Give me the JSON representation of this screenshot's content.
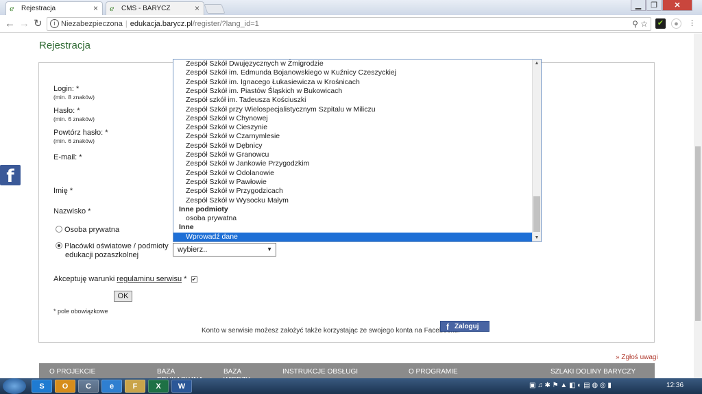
{
  "browser": {
    "tabs": [
      {
        "title": "Rejestracja"
      },
      {
        "title": "CMS - BARYCZ"
      }
    ],
    "address": {
      "security_label": "Niezabezpieczona",
      "host": "edukacja.barycz.pl",
      "path": "/register/?lang_id=1"
    }
  },
  "page": {
    "title": "Rejestracja",
    "fields": {
      "login": {
        "label": "Login: *",
        "hint": "(min. 8 znaków)"
      },
      "password": {
        "label": "Hasło: *",
        "hint": "(min. 6 znaków)"
      },
      "password_repeat": {
        "label": "Powtórz hasło: *",
        "hint": "(min. 6 znaków)"
      },
      "email": {
        "label": "E-mail: *"
      },
      "first_name": {
        "label": "Imię *"
      },
      "last_name": {
        "label": "Nazwisko *"
      }
    },
    "radio": {
      "private": "Osoba prywatna",
      "institution_line1": "Placówki oświatowe / podmioty",
      "institution_line2": "edukacji pozaszkolnej"
    },
    "select": {
      "value": "wybierz..",
      "options": [
        {
          "label": "Zespół Szkół Dwujęzycznych w Żmigrodzie"
        },
        {
          "label": "Zespół Szkół im. Edmunda Bojanowskiego w Kuźnicy Czeszyckiej"
        },
        {
          "label": "Zespół Szkół im. Ignacego Łukasiewicza w Krośnicach"
        },
        {
          "label": "Zespół Szkół im. Piastów Śląskich w Bukowicach"
        },
        {
          "label": "Zespół szkół im. Tadeusza Kościuszki"
        },
        {
          "label": "Zespół Szkół przy Wielospecjalistycznym Szpitalu w Miliczu"
        },
        {
          "label": "Zespół Szkół w Chynowej"
        },
        {
          "label": "Zespół Szkół w Cieszynie"
        },
        {
          "label": "Zespół Szkół w Czarnymlesie"
        },
        {
          "label": "Zespół Szkół w Dębnicy"
        },
        {
          "label": "Zespół Szkół w Granowcu"
        },
        {
          "label": "Zespół Szkół w Jankowie Przygodzkim"
        },
        {
          "label": "Zespół Szkół w Odolanowie"
        },
        {
          "label": "Zespół Szkół w Pawłowie"
        },
        {
          "label": "Zespół Szkół w Przygodzicach"
        },
        {
          "label": "Zespół Szkół w Wysocku Małym"
        },
        {
          "label": "Inne podmioty",
          "group": true
        },
        {
          "label": "osoba prywatna"
        },
        {
          "label": "Inne",
          "group": true
        },
        {
          "label": "Wprowadź dane",
          "selected": true
        }
      ]
    },
    "accept": {
      "prefix": "Akceptuję warunki",
      "link": "regulaminu serwisu",
      "suffix": "*",
      "checked": true
    },
    "ok_button": "OK",
    "required_note": "* pole obowiązkowe",
    "facebook_note": "Konto w serwisie możesz założyć także korzystając ze swojego konta na Facebooku:",
    "facebook_button": "Zaloguj się",
    "report_link": "» Zgłoś uwagi",
    "footer_nav": [
      {
        "label": "O PROJEKCIE"
      },
      {
        "label": "BAZA EDUKACYJNA"
      },
      {
        "label": "BAZA WIEDZY"
      },
      {
        "label": "INSTRUKCJE OBSŁUGI"
      },
      {
        "label": "O PROGRAMIE"
      },
      {
        "label": "SZLAKI DOLINY BARYCZY"
      }
    ]
  },
  "taskbar": {
    "clock": "12:36",
    "apps": [
      "S",
      "O",
      "C",
      "e",
      "F",
      "X",
      "W"
    ]
  },
  "colors": {
    "title_green": "#2f6a33",
    "selection_blue": "#1e6fd6",
    "facebook_blue": "#3b5998",
    "footer_gray": "#8b8b8b"
  }
}
